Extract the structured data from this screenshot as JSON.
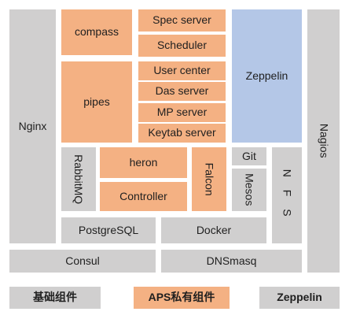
{
  "colors": {
    "gray": "#D0CFCF",
    "orange": "#F4B183",
    "blue": "#B4C7E7"
  },
  "diagram": {
    "blocks": {
      "nginx": "Nginx",
      "compass": "compass",
      "pipes": "pipes",
      "spec_server": "Spec server",
      "scheduler": "Scheduler",
      "user_center": "User center",
      "das_server": "Das server",
      "mp_server": "MP server",
      "keytab_server": "Keytab server",
      "zeppelin": "Zeppelin",
      "nagios": "Nagios",
      "rabbitmq": "RabbitMQ",
      "heron": "heron",
      "controller": "Controller",
      "falcon": "Falcon",
      "git": "Git",
      "mesos": "Mesos",
      "nfs": "N F S",
      "postgresql": "PostgreSQL",
      "docker": "Docker",
      "consul": "Consul",
      "dnsmasq": "DNSmasq"
    },
    "legend": {
      "basic_components": "基础组件",
      "aps_private_components": "APS私有组件",
      "zeppelin": "Zeppelin"
    }
  }
}
